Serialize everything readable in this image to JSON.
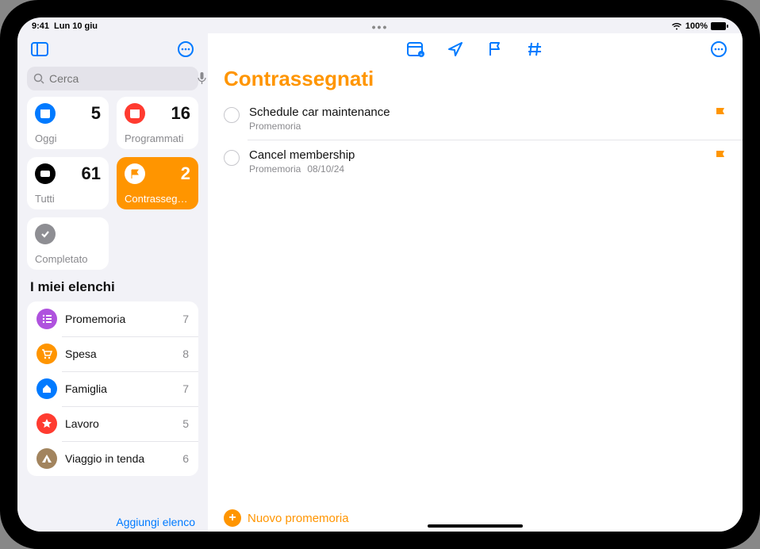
{
  "statusbar": {
    "time": "9:41",
    "date": "Lun 10 giu",
    "battery_pct": "100%"
  },
  "search": {
    "placeholder": "Cerca"
  },
  "smart": [
    {
      "id": "today",
      "label": "Oggi",
      "count": 5,
      "icon": "calendar",
      "color": "bg-blue"
    },
    {
      "id": "scheduled",
      "label": "Programmati",
      "count": 16,
      "icon": "calendar",
      "color": "bg-red"
    },
    {
      "id": "all",
      "label": "Tutti",
      "count": 61,
      "icon": "tray",
      "color": "bg-darker"
    },
    {
      "id": "flagged",
      "label": "Contrasseg…",
      "count": 2,
      "icon": "flag",
      "color": "bg-orange",
      "active": true
    },
    {
      "id": "completed",
      "label": "Completato",
      "count": "",
      "icon": "check",
      "color": "bg-gray"
    }
  ],
  "listsHeader": "I miei elenchi",
  "lists": [
    {
      "name": "Promemoria",
      "count": 7,
      "color": "bg-purple",
      "icon": "list"
    },
    {
      "name": "Spesa",
      "count": 8,
      "color": "bg-orange2",
      "icon": "cart"
    },
    {
      "name": "Famiglia",
      "count": 7,
      "color": "bg-bluehome",
      "icon": "home"
    },
    {
      "name": "Lavoro",
      "count": 5,
      "color": "bg-redstar",
      "icon": "star"
    },
    {
      "name": "Viaggio in tenda",
      "count": 6,
      "color": "bg-tent",
      "icon": "tent"
    }
  ],
  "sidebarFooter": {
    "addList": "Aggiungi elenco"
  },
  "main": {
    "title": "Contrassegnati",
    "newReminder": "Nuovo promemoria"
  },
  "reminders": [
    {
      "title": "Schedule car maintenance",
      "list": "Promemoria",
      "date": ""
    },
    {
      "title": "Cancel membership",
      "list": "Promemoria",
      "date": "08/10/24"
    }
  ]
}
